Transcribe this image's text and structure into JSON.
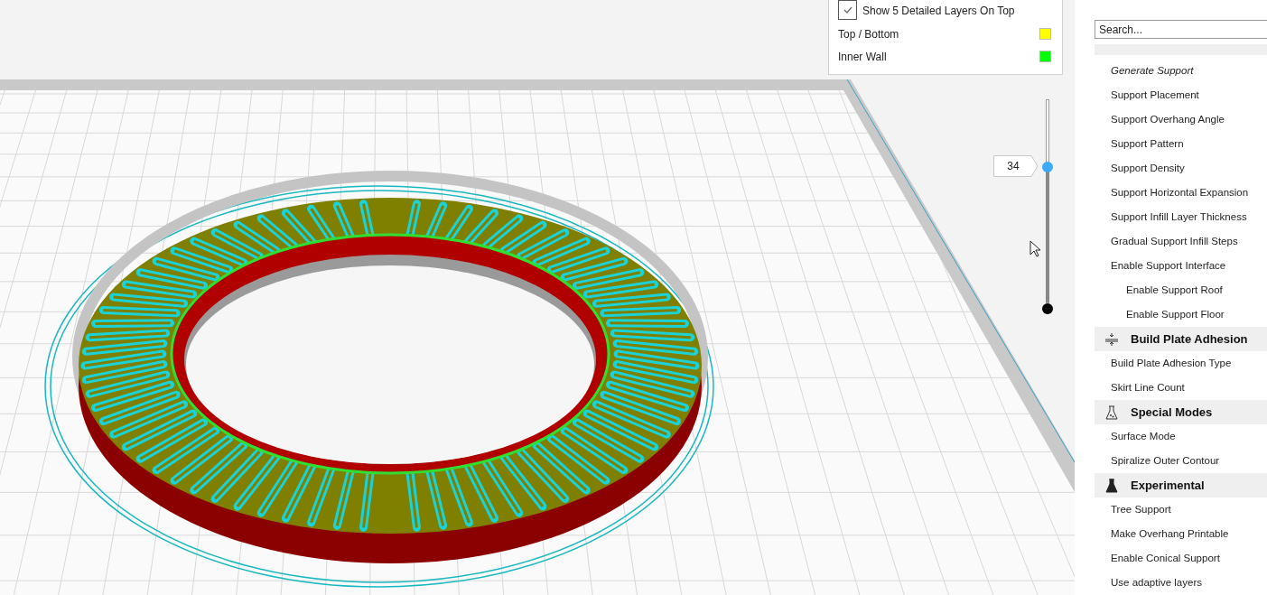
{
  "legend": {
    "items": [
      {
        "kind": "checkbox",
        "label": "Show 5 Detailed Layers On Top",
        "checked": true
      },
      {
        "kind": "swatch",
        "label": "Top / Bottom",
        "color": "#ffff00"
      },
      {
        "kind": "swatch",
        "label": "Inner Wall",
        "color": "#00ff00"
      }
    ]
  },
  "layer_slider": {
    "value": "34",
    "level": 0.67
  },
  "sidebar": {
    "search": {
      "placeholder": "Search..."
    },
    "items": [
      {
        "kind": "setting",
        "label": "Generate Support",
        "modified": true
      },
      {
        "kind": "setting",
        "label": "Support Placement",
        "modified": false
      },
      {
        "kind": "setting",
        "label": "Support Overhang Angle",
        "modified": false
      },
      {
        "kind": "setting",
        "label": "Support Pattern",
        "modified": false
      },
      {
        "kind": "setting",
        "label": "Support Density",
        "modified": false
      },
      {
        "kind": "setting",
        "label": "Support Horizontal Expansion",
        "modified": false
      },
      {
        "kind": "setting",
        "label": "Support Infill Layer Thickness",
        "modified": false
      },
      {
        "kind": "setting",
        "label": "Gradual Support Infill Steps",
        "modified": false
      },
      {
        "kind": "setting",
        "label": "Enable Support Interface",
        "modified": false,
        "children": [
          {
            "kind": "setting",
            "label": "Enable Support Roof",
            "modified": false
          },
          {
            "kind": "setting",
            "label": "Enable Support Floor",
            "modified": false
          }
        ]
      },
      {
        "kind": "category",
        "label": "Build Plate Adhesion"
      },
      {
        "kind": "setting",
        "label": "Build Plate Adhesion Type",
        "modified": false
      },
      {
        "kind": "setting",
        "label": "Skirt Line Count",
        "modified": false
      },
      {
        "kind": "category",
        "label": "Special Modes"
      },
      {
        "kind": "setting",
        "label": "Surface Mode",
        "modified": false
      },
      {
        "kind": "setting",
        "label": "Spiralize Outer Contour",
        "modified": false
      },
      {
        "kind": "category",
        "label": "Experimental"
      },
      {
        "kind": "setting",
        "label": "Tree Support",
        "modified": false
      },
      {
        "kind": "setting",
        "label": "Make Overhang Printable",
        "modified": false
      },
      {
        "kind": "setting",
        "label": "Enable Conical Support",
        "modified": false
      },
      {
        "kind": "setting",
        "label": "Use adaptive layers",
        "modified": false
      }
    ]
  }
}
